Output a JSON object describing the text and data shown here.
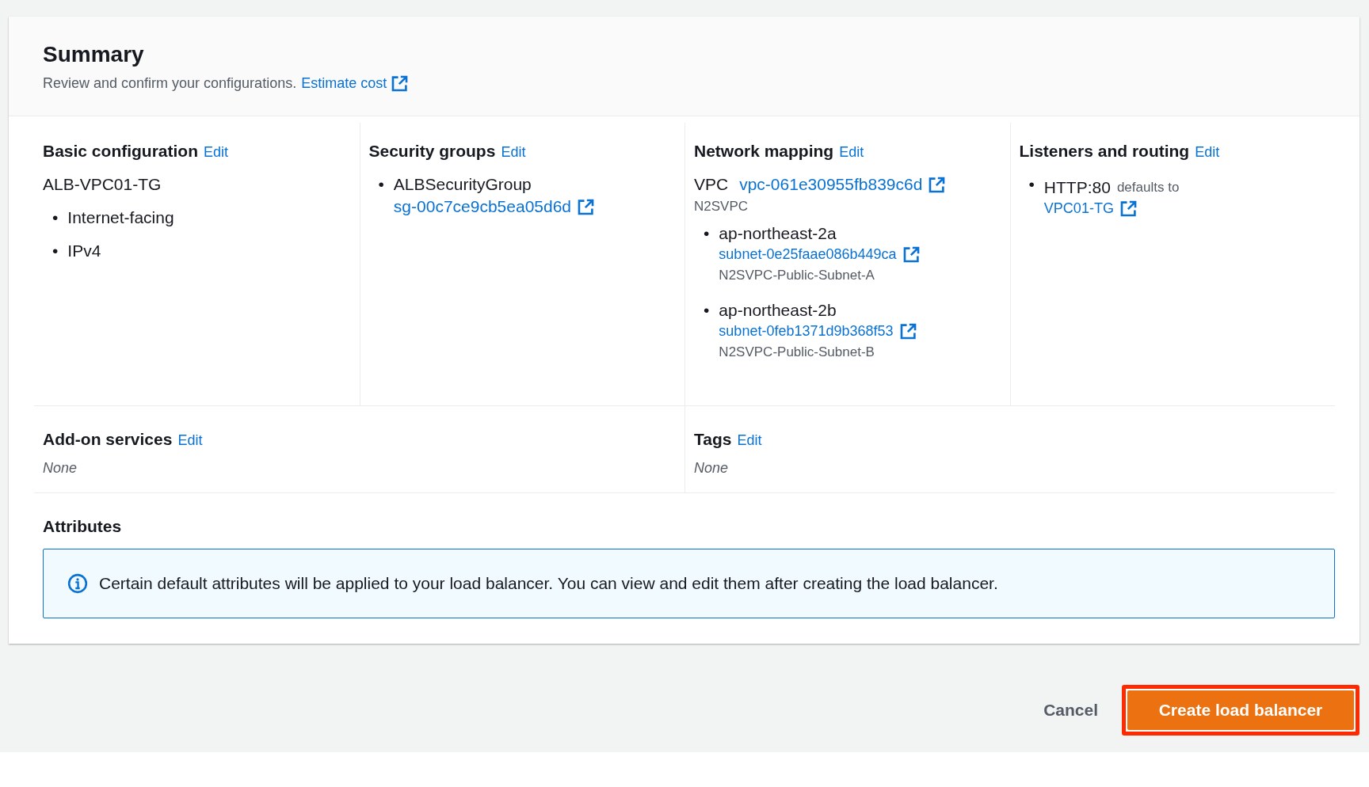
{
  "summary": {
    "title": "Summary",
    "description": "Review and confirm your configurations.",
    "link": "Estimate cost"
  },
  "basic_configuration": {
    "title": "Basic configuration",
    "edit": "Edit",
    "name": "ALB-VPC01-TG",
    "items": [
      "Internet-facing",
      "IPv4"
    ]
  },
  "security_groups": {
    "title": "Security groups",
    "edit": "Edit",
    "groups": [
      {
        "name": "ALBSecurityGroup",
        "id": "sg-00c7ce9cb5ea05d6d"
      }
    ]
  },
  "network_mapping": {
    "title": "Network mapping",
    "edit": "Edit",
    "vpc_label": "VPC",
    "vpc_id": "vpc-061e30955fb839c6d",
    "vpc_name": "N2SVPC",
    "subnets": [
      {
        "zone": "ap-northeast-2a",
        "subnet_id": "subnet-0e25faae086b449ca",
        "subnet_name": "N2SVPC-Public-Subnet-A"
      },
      {
        "zone": "ap-northeast-2b",
        "subnet_id": "subnet-0feb1371d9b368f53",
        "subnet_name": "N2SVPC-Public-Subnet-B"
      }
    ]
  },
  "listeners_and_routing": {
    "title": "Listeners and routing",
    "edit": "Edit",
    "listeners": [
      {
        "listener": "HTTP:80",
        "note": "defaults to",
        "target": "VPC01-TG"
      }
    ]
  },
  "add_on_services": {
    "title": "Add-on services",
    "edit": "Edit",
    "value": "None"
  },
  "tags": {
    "title": "Tags",
    "edit": "Edit",
    "value": "None"
  },
  "attributes": {
    "title": "Attributes",
    "info": "Certain default attributes will be applied to your load balancer. You can view and edit them after creating the load balancer."
  },
  "actions": {
    "cancel": "Cancel",
    "primary": "Create load balancer"
  },
  "bullet": "•"
}
